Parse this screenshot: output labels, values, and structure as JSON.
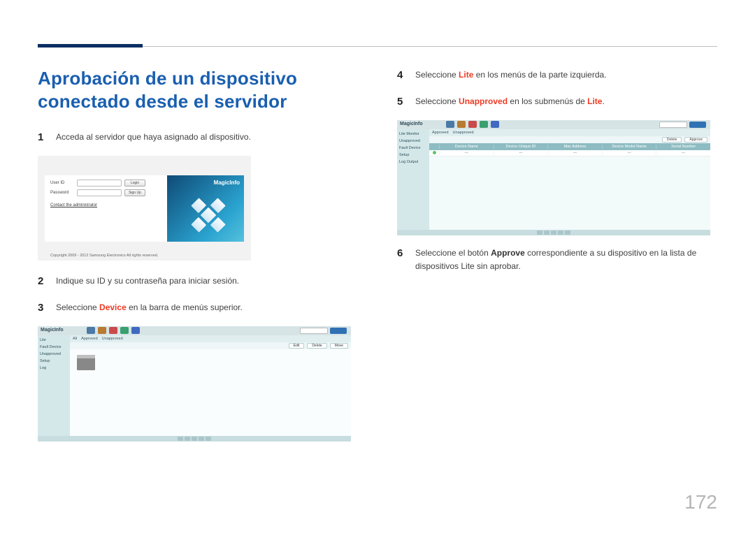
{
  "title": "Aprobación de un dispositivo conectado desde el servidor",
  "page_number": "172",
  "steps": {
    "s1": {
      "num": "1",
      "text": "Acceda al servidor que haya asignado al dispositivo."
    },
    "s2": {
      "num": "2",
      "text": "Indique su ID y su contraseña para iniciar sesión."
    },
    "s3": {
      "num": "3",
      "pre": "Seleccione ",
      "hl": "Device",
      "post": " en la barra de menús superior."
    },
    "s4": {
      "num": "4",
      "pre": "Seleccione ",
      "hl": "Lite",
      "post": " en los menús de la parte izquierda."
    },
    "s5": {
      "num": "5",
      "pre": "Seleccione ",
      "hl": "Unapproved",
      "post_a": " en los submenús de ",
      "hl2": "Lite",
      "post_b": "."
    },
    "s6": {
      "num": "6",
      "pre": "Seleccione el botón ",
      "hl": "Approve",
      "post": " correspondiente a su dispositivo en la lista de dispositivos Lite sin aprobar."
    }
  },
  "login": {
    "user_label": "User ID",
    "pass_label": "Password",
    "login_btn": "Login",
    "signup_btn": "Sign Up",
    "contact": "Contact the administrator",
    "copyright": "Copyright 2009 - 2012 Samsung Electronics All rights reserved.",
    "brand": "MagicInfo"
  },
  "app": {
    "logo": "MagicInfo",
    "side": {
      "a": "Lite",
      "b": "Fault Device",
      "c": "Unapproved",
      "d": "Setup",
      "e": "Log"
    },
    "sub": {
      "a": "All",
      "b": "Approved",
      "c": "Unapproved"
    },
    "side2": {
      "a": "Lite Monitor",
      "b": "Unapproved",
      "c": "Fault Device",
      "d": "Setup",
      "e": "Log Output"
    },
    "tool": {
      "a": "Edit",
      "b": "Delete",
      "c": "Move",
      "d": "Approve"
    },
    "cols": {
      "c0": "",
      "c1": "Device Name",
      "c2": "Device Unique ID",
      "c3": "Mac Address",
      "c4": "Device Model Name",
      "c5": "Serial Number"
    }
  }
}
